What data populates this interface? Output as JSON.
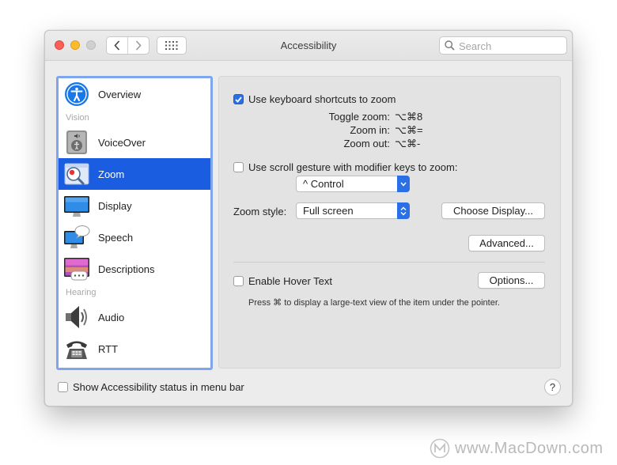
{
  "window": {
    "title": "Accessibility"
  },
  "search": {
    "placeholder": "Search"
  },
  "sidebar": {
    "items": [
      {
        "label": "Overview",
        "icon": "accessibility-icon"
      },
      {
        "label": "VoiceOver",
        "icon": "voiceover-icon"
      },
      {
        "label": "Zoom",
        "icon": "zoom-icon",
        "selected": true
      },
      {
        "label": "Display",
        "icon": "display-icon"
      },
      {
        "label": "Speech",
        "icon": "speech-icon"
      },
      {
        "label": "Descriptions",
        "icon": "descriptions-icon"
      },
      {
        "label": "Audio",
        "icon": "speaker-icon"
      },
      {
        "label": "RTT",
        "icon": "telephone-icon"
      }
    ],
    "sections": {
      "vision": "Vision",
      "hearing": "Hearing"
    }
  },
  "zoom": {
    "keyboard_shortcuts": {
      "label": "Use keyboard shortcuts to zoom",
      "checked": true
    },
    "toggle_zoom": {
      "label": "Toggle zoom:",
      "keys": "⌥⌘8"
    },
    "zoom_in": {
      "label": "Zoom in:",
      "keys": "⌥⌘="
    },
    "zoom_out": {
      "label": "Zoom out:",
      "keys": "⌥⌘-"
    },
    "scroll_gesture": {
      "label": "Use scroll gesture with modifier keys to zoom:",
      "checked": false
    },
    "modifier": {
      "selected": "^ Control"
    },
    "zoom_style": {
      "label": "Zoom style:",
      "selected": "Full screen"
    },
    "choose_display_label": "Choose Display...",
    "advanced_label": "Advanced...",
    "hover_text": {
      "label": "Enable Hover Text",
      "checked": false
    },
    "options_label": "Options...",
    "hover_hint": "Press ⌘ to display a large-text view of the item under the pointer."
  },
  "footer": {
    "status_label": "Show Accessibility status in menu bar",
    "checked": false,
    "help_label": "?"
  },
  "watermark": {
    "text": "www.MacDown.com"
  },
  "colors": {
    "accent": "#1b5de0",
    "checkbox_on": "#2a6fe6",
    "sidebar_border": "#7ea6ee"
  }
}
